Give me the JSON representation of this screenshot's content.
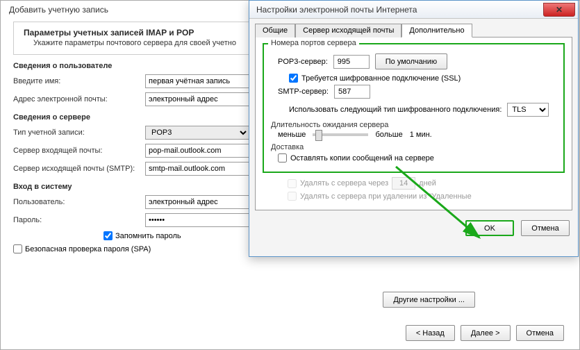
{
  "back": {
    "title": "Добавить учетную запись",
    "header": {
      "h": "Параметры учетных записей IMAP и POP",
      "p": "Укажите параметры почтового сервера для своей учетно"
    },
    "user_section": "Сведения о пользователе",
    "name_label": "Введите имя:",
    "name_value": "первая учётная запись",
    "email_label": "Адрес электронной почты:",
    "email_value": "электронный адрес",
    "server_section": "Сведения о сервере",
    "acct_type_label": "Тип учетной записи:",
    "acct_type_value": "POP3",
    "incoming_label": "Сервер входящей почты:",
    "incoming_value": "pop-mail.outlook.com",
    "outgoing_label": "Сервер исходящей почты (SMTP):",
    "outgoing_value": "smtp-mail.outlook.com",
    "login_section": "Вход в систему",
    "user_label": "Пользователь:",
    "user_value": "электронный адрес",
    "pass_label": "Пароль:",
    "pass_value": "******",
    "remember": "Запомнить пароль",
    "spa": "Безопасная проверка пароля (SPA)",
    "other": "Другие настройки ...",
    "footer": {
      "back": "< Назад",
      "next": "Далее >",
      "cancel": "Отмена"
    }
  },
  "front": {
    "title": "Настройки электронной почты Интернета",
    "tabs": {
      "general": "Общие",
      "outgoing": "Сервер исходящей почты",
      "advanced": "Дополнительно"
    },
    "ports_legend": "Номера портов сервера",
    "pop3_label": "POP3-сервер:",
    "pop3_value": "995",
    "defaults_btn": "По умолчанию",
    "ssl_chk": "Требуется шифрованное подключение (SSL)",
    "smtp_label": "SMTP-сервер:",
    "smtp_value": "587",
    "enc_label": "Использовать следующий тип шифрованного подключения:",
    "enc_value": "TLS",
    "timeout_label": "Длительность ожидания сервера",
    "less": "меньше",
    "more": "больше",
    "timeout_val": "1 мин.",
    "delivery_label": "Доставка",
    "leave_chk": "Оставлять копии сообщений на сервере",
    "remove_after": "Удалять с сервера через",
    "days_val": "14",
    "days_suffix": "дней",
    "remove_deleted": "Удалять с сервера при удалении из \"Удаленные",
    "ok": "OK",
    "cancel": "Отмена"
  }
}
